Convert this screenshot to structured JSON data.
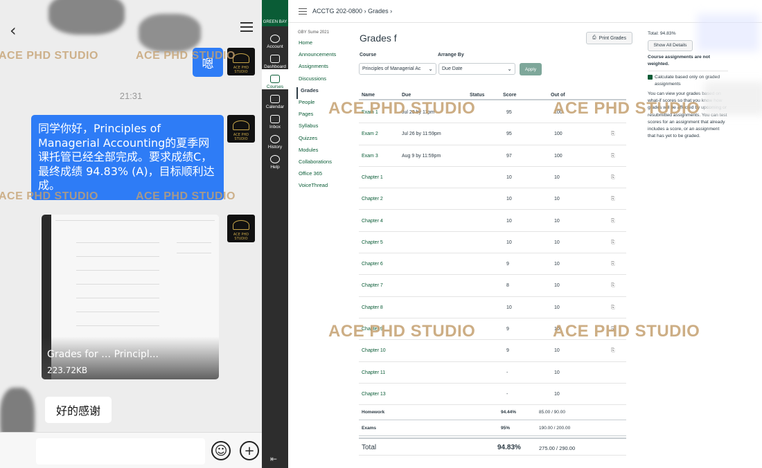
{
  "watermark": "ACE PHD STUDIO",
  "chat": {
    "bubble_short": "嗯",
    "time": "21:31",
    "message": "同学你好，Principles of Managerial Accounting的夏季网课托管已经全部完成。要求成绩C，最终成绩 94.83% (A)，目标顺利达成。",
    "file_name": "Grades for … Principl...",
    "file_size": "223.72KB",
    "reply": "好的感谢",
    "avatar_text": "ACE PHD STUDIO",
    "back_glyph": "‹",
    "emoji_glyph": "☺",
    "add_glyph": "+",
    "colors": {
      "bubble": "#2e7cf6",
      "background": "#ededed"
    }
  },
  "global_nav": {
    "logo_text": "GREEN BAY",
    "items": [
      "Account",
      "Dashboard",
      "Courses",
      "Calendar",
      "Inbox",
      "History",
      "Help"
    ],
    "active": "Courses",
    "collapse_glyph": "⇤"
  },
  "breadcrumb": {
    "course": "ACCTG 202-0800",
    "sep": "›",
    "page": "Grades",
    "sep2": "›"
  },
  "course_nav": {
    "term": "GBY Sume 2021",
    "items": [
      "Home",
      "Announcements",
      "Assignments",
      "Discussions",
      "Grades",
      "People",
      "Pages",
      "Syllabus",
      "Quizzes",
      "Modules",
      "Collaborations",
      "Office 365",
      "VoiceThread"
    ],
    "active": "Grades"
  },
  "page_title": "Grades f",
  "print_button": "Print Grades",
  "filters": {
    "course_label": "Course",
    "arrange_label": "Arrange By",
    "course_value": "Principles of Managerial Ac",
    "arrange_value": "Due Date",
    "apply_label": "Apply"
  },
  "table": {
    "headers": [
      "Name",
      "Due",
      "Status",
      "Score",
      "Out of"
    ],
    "rows": [
      {
        "name": "Exam 1",
        "due": "Jul 20 by 11pm",
        "score": "95",
        "out_of": "100"
      },
      {
        "name": "Exam 2",
        "due": "Jul 26 by 11:59pm",
        "score": "95",
        "out_of": "100"
      },
      {
        "name": "Exam 3",
        "due": "Aug 9 by 11:59pm",
        "score": "97",
        "out_of": "100"
      },
      {
        "name": "Chapter 1",
        "due": "",
        "score": "10",
        "out_of": "10"
      },
      {
        "name": "Chapter 2",
        "due": "",
        "score": "10",
        "out_of": "10"
      },
      {
        "name": "Chapter 4",
        "due": "",
        "score": "10",
        "out_of": "10"
      },
      {
        "name": "Chapter 5",
        "due": "",
        "score": "10",
        "out_of": "10"
      },
      {
        "name": "Chapter 6",
        "due": "",
        "score": "9",
        "out_of": "10"
      },
      {
        "name": "Chapter 7",
        "due": "",
        "score": "8",
        "out_of": "10"
      },
      {
        "name": "Chapter 8",
        "due": "",
        "score": "10",
        "out_of": "10"
      },
      {
        "name": "Chapter 9",
        "due": "",
        "score": "9",
        "out_of": "10"
      },
      {
        "name": "Chapter 10",
        "due": "",
        "score": "9",
        "out_of": "10"
      },
      {
        "name": "Chapter 11",
        "due": "",
        "score": "-",
        "out_of": "10"
      },
      {
        "name": "Chapter 13",
        "due": "",
        "score": "-",
        "out_of": "10"
      }
    ],
    "summary": [
      {
        "name": "Homework",
        "percent": "94.44%",
        "points": "85.00 / 90.00"
      },
      {
        "name": "Exams",
        "percent": "95%",
        "points": "190.00 / 200.00"
      }
    ],
    "total": {
      "name": "Total",
      "percent": "94.83%",
      "points": "275.00 / 290.00"
    }
  },
  "right_panel": {
    "total": "Total: 94.83%",
    "show_all": "Show All Details",
    "not_weighted": "Course assignments are not weighted.",
    "calc_label": "Calculate based only on graded assignments",
    "help_text": "You can view your grades based on what-if scores so that you know how grades will be affected by upcoming or resubmitted assignments. You can test scores for an assignment that already includes a score, or an assignment that has yet to be graded."
  }
}
